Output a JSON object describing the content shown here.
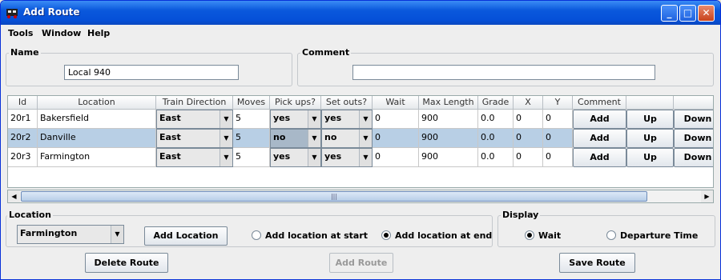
{
  "window": {
    "title": "Add Route"
  },
  "menu": [
    "Tools",
    "Window",
    "Help"
  ],
  "name": {
    "label": "Name",
    "value": "Local 940"
  },
  "comment": {
    "label": "Comment",
    "value": ""
  },
  "table": {
    "headers": [
      "Id",
      "Location",
      "Train Direction",
      "Moves",
      "Pick ups?",
      "Set outs?",
      "Wait",
      "Max Length",
      "Grade",
      "X",
      "Y",
      "Comment",
      "",
      ""
    ],
    "rows": [
      {
        "id": "20r1",
        "location": "Bakersfield",
        "direction": "East",
        "moves": "5",
        "pickups": "yes",
        "setouts": "yes",
        "wait": "0",
        "maxlen": "900",
        "grade": "0.0",
        "x": "0",
        "y": "0",
        "add": "Add",
        "up": "Up",
        "down": "Down"
      },
      {
        "id": "20r2",
        "location": "Danville",
        "direction": "East",
        "moves": "5",
        "pickups": "no",
        "setouts": "no",
        "wait": "0",
        "maxlen": "900",
        "grade": "0.0",
        "x": "0",
        "y": "0",
        "add": "Add",
        "up": "Up",
        "down": "Down"
      },
      {
        "id": "20r3",
        "location": "Farmington",
        "direction": "East",
        "moves": "5",
        "pickups": "yes",
        "setouts": "yes",
        "wait": "0",
        "maxlen": "900",
        "grade": "0.0",
        "x": "0",
        "y": "0",
        "add": "Add",
        "up": "Up",
        "down": "Down"
      }
    ],
    "selected_row_index": 1
  },
  "location": {
    "label": "Location",
    "selected": "Farmington",
    "add_button": "Add Location",
    "opt_start": "Add location at start",
    "opt_end": "Add location at end",
    "selected_option": "end"
  },
  "display": {
    "label": "Display",
    "opt_wait": "Wait",
    "opt_departure": "Departure Time",
    "selected_option": "wait"
  },
  "buttons": {
    "delete": "Delete Route",
    "add": "Add Route",
    "save": "Save Route"
  },
  "colors": {
    "title_bar": "#0a58dc",
    "selection": "#b8cfe5",
    "window_bg": "#eeeeee"
  }
}
